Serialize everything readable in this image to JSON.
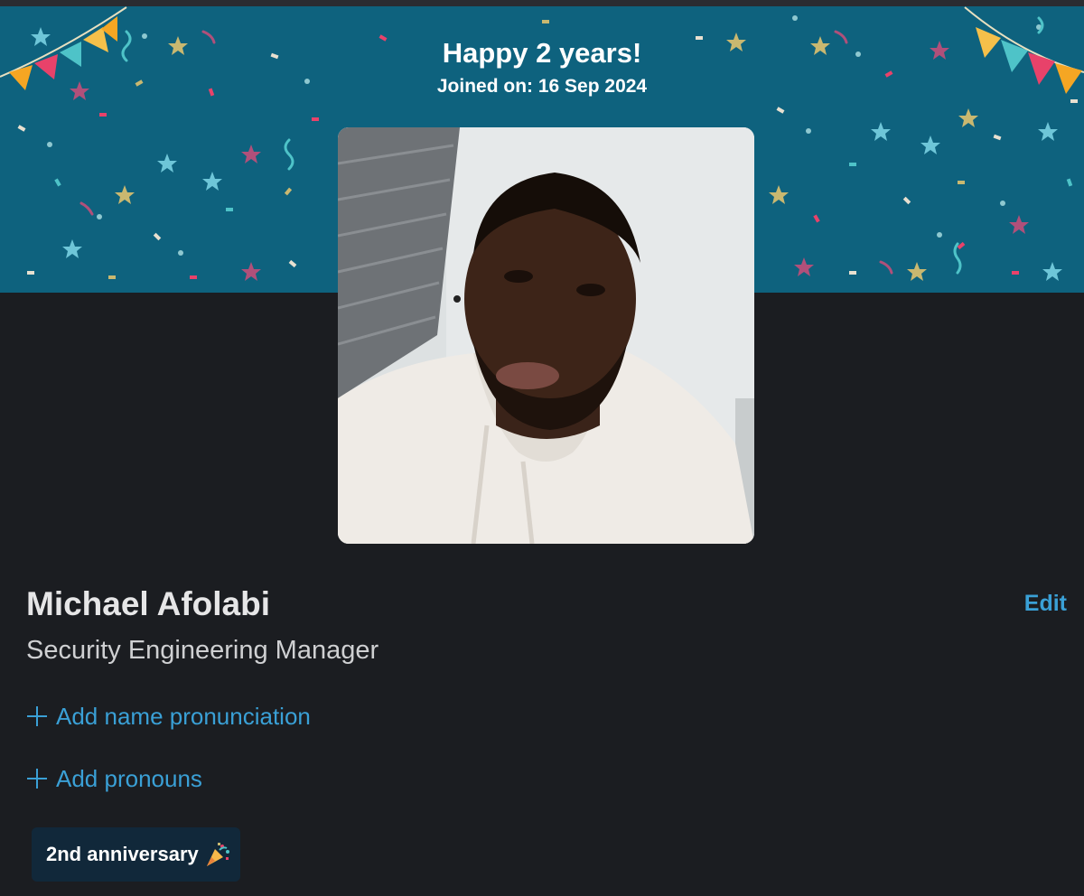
{
  "banner": {
    "title": "Happy 2 years!",
    "joined": "Joined on: 16 Sep 2024",
    "background_color": "#0e627e"
  },
  "profile": {
    "name": "Michael Afolabi",
    "job_title": "Security Engineering Manager",
    "edit_label": "Edit",
    "add_pronunciation_label": "Add name pronunciation",
    "add_pronouns_label": "Add pronouns",
    "photo_icon": "profile-photo"
  },
  "badge": {
    "label": "2nd anniversary",
    "emoji_icon": "party-popper-icon"
  },
  "colors": {
    "link": "#3aa0d6",
    "background": "#1b1d21",
    "badge_bg": "#11283a"
  }
}
